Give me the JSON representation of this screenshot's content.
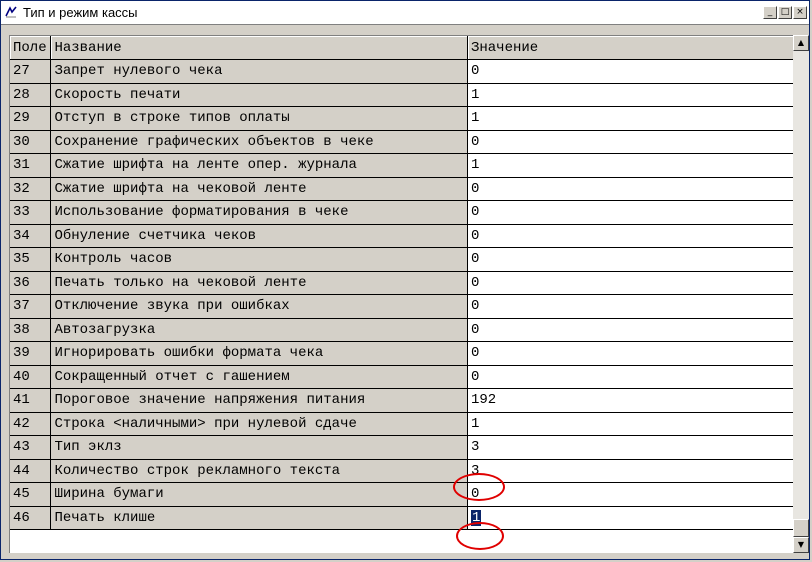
{
  "window": {
    "title": "Тип и режим кассы",
    "min_symbol": "_",
    "max_symbol": "□",
    "close_symbol": "×"
  },
  "grid": {
    "columns": [
      "Поле",
      "Название",
      "Значение"
    ],
    "rows": [
      {
        "field": "27",
        "name": "Запрет нулевого чека",
        "value": "0"
      },
      {
        "field": "28",
        "name": "Скорость печати",
        "value": "1"
      },
      {
        "field": "29",
        "name": "Отступ в строке типов оплаты",
        "value": "1"
      },
      {
        "field": "30",
        "name": "Сохранение графических объектов в чеке",
        "value": "0"
      },
      {
        "field": "31",
        "name": "Сжатие шрифта на ленте опер. журнала",
        "value": "1"
      },
      {
        "field": "32",
        "name": "Сжатие шрифта на чековой ленте",
        "value": "0"
      },
      {
        "field": "33",
        "name": "Использование форматирования в чеке",
        "value": "0"
      },
      {
        "field": "34",
        "name": "Обнуление счетчика чеков",
        "value": "0"
      },
      {
        "field": "35",
        "name": "Контроль часов",
        "value": "0"
      },
      {
        "field": "36",
        "name": "Печать только на чековой ленте",
        "value": "0"
      },
      {
        "field": "37",
        "name": "Отключение звука при ошибках",
        "value": "0"
      },
      {
        "field": "38",
        "name": "Автозагрузка",
        "value": "0"
      },
      {
        "field": "39",
        "name": "Игнорировать ошибки формата чека",
        "value": "0"
      },
      {
        "field": "40",
        "name": "Сокращенный отчет с гашением",
        "value": "0"
      },
      {
        "field": "41",
        "name": "Пороговое значение напряжения питания",
        "value": "192"
      },
      {
        "field": "42",
        "name": "Строка <наличными> при нулевой сдаче",
        "value": "1"
      },
      {
        "field": "43",
        "name": "Тип эклз",
        "value": "3"
      },
      {
        "field": "44",
        "name": "Количество строк рекламного текста",
        "value": "3"
      },
      {
        "field": "45",
        "name": "Ширина бумаги",
        "value": "0"
      },
      {
        "field": "46",
        "name": "Печать клише",
        "value": "1"
      }
    ],
    "selected_row_index": 19
  },
  "colors": {
    "face": "#d4d0c8",
    "selection": "#0a246a",
    "annotation": "#e00000"
  },
  "scrollbar": {
    "up_arrow": "▲",
    "down_arrow": "▼"
  }
}
